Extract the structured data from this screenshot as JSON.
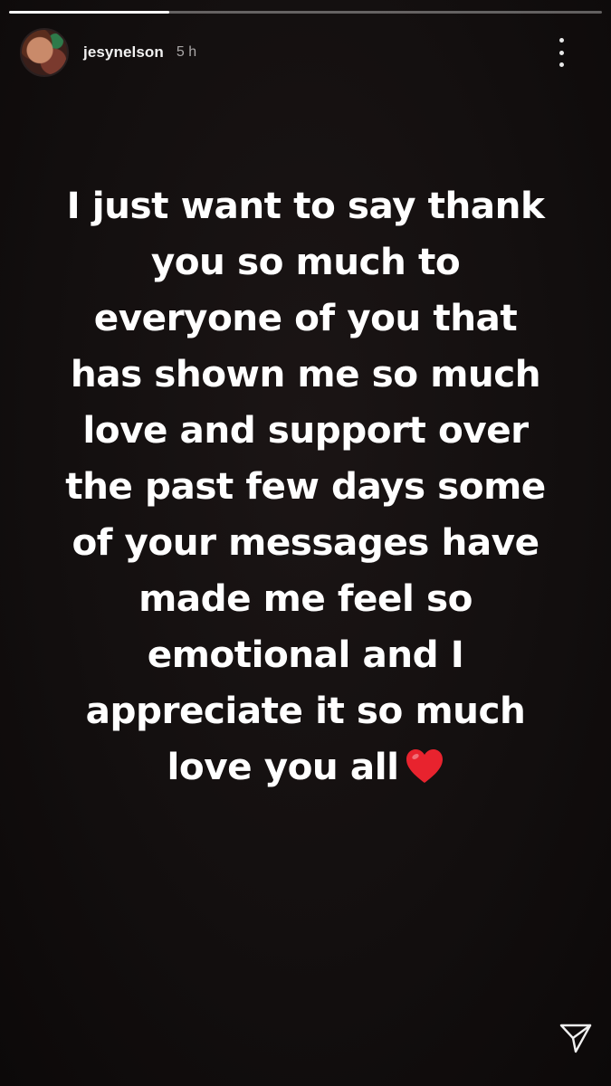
{
  "progress": {
    "fraction": 0.27
  },
  "header": {
    "avatar_icon": "profile-avatar",
    "username": "jesynelson",
    "timestamp": "5 h",
    "more_icon": "more-vertical-icon"
  },
  "story": {
    "lines": [
      "I just want to say thank",
      "you so much to",
      "everyone of you that",
      "has shown me so much",
      "love and support over",
      "the past few days some",
      "of your messages have",
      "made me feel so",
      "emotional and I",
      "appreciate it so much",
      "love you all"
    ],
    "emoji": "heart-emoji",
    "emoji_color": "#e8232e"
  },
  "footer": {
    "share_icon": "send-icon"
  },
  "colors": {
    "background": "#130f0f",
    "text": "#ffffff",
    "timestamp": "#a9a6a6"
  }
}
